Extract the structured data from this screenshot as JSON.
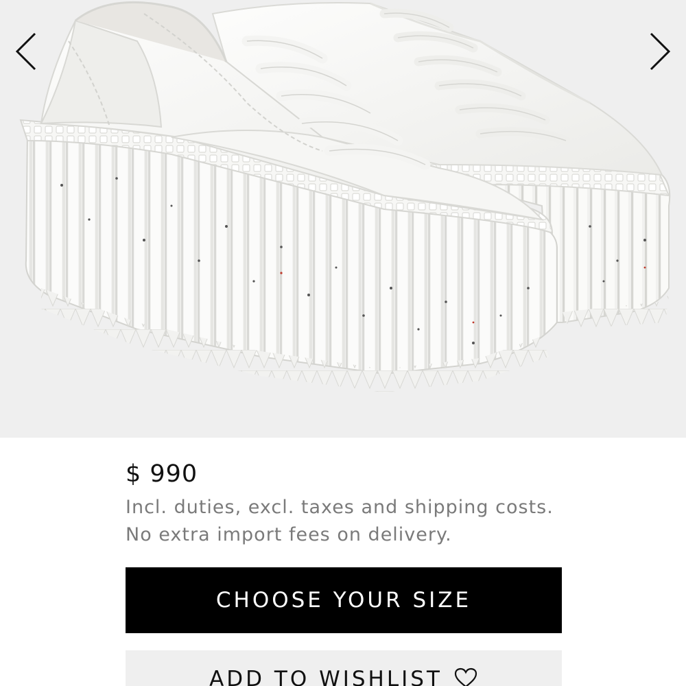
{
  "gallery": {
    "image_alt": "White platform sneakers",
    "prev_icon": "chevron-left-icon",
    "next_icon": "chevron-right-icon",
    "background": "#efefef"
  },
  "product": {
    "price": "$ 990",
    "price_note_line1": "Incl. duties, excl. taxes and shipping costs.",
    "price_note_line2": "No extra import fees on delivery."
  },
  "actions": {
    "choose_size_label": "CHOOSE YOUR SIZE",
    "wishlist_label": "ADD TO WISHLIST",
    "wishlist_icon": "heart-icon"
  },
  "colors": {
    "primary_button": "#000000",
    "secondary_button": "#efefef",
    "note_text": "#7a7a7a"
  }
}
